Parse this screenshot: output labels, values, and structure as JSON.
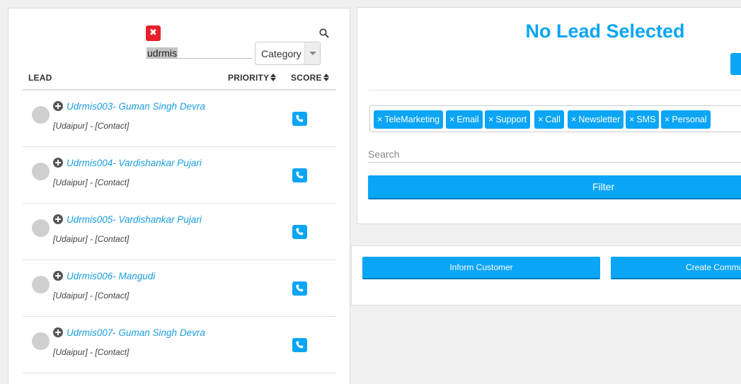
{
  "search": {
    "clear_symbol": "✖",
    "query": "udrmis",
    "category_selected": "Category"
  },
  "table": {
    "headers": {
      "lead": "LEAD",
      "priority": "PRIORITY",
      "score": "SCORE"
    },
    "rows": [
      {
        "name": "Udrmis003- Guman Singh Devra",
        "sub": "[Udaipur] - [Contact]"
      },
      {
        "name": "Udrmis004- Vardishankar Pujari",
        "sub": "[Udaipur] - [Contact]"
      },
      {
        "name": "Udrmis005- Vardishankar Pujari",
        "sub": "[Udaipur] - [Contact]"
      },
      {
        "name": "Udrmis006- Mangudi",
        "sub": "[Udaipur] - [Contact]"
      },
      {
        "name": "Udrmis007- Guman Singh Devra",
        "sub": "[Udaipur] - [Contact]"
      }
    ]
  },
  "detail": {
    "title": "No Lead Selected",
    "tags": [
      "TeleMarketing",
      "Email",
      "Support",
      "Call",
      "Newsletter",
      "SMS",
      "Personal"
    ],
    "tag_remove_symbol": "×",
    "search_placeholder": "Search",
    "filter_label": "Filter"
  },
  "actions": {
    "inform_label": "Inform Customer",
    "create_label": "Create Commu"
  },
  "colors": {
    "accent": "#0aa5f5",
    "danger": "#e8202a",
    "link": "#1a9de0"
  },
  "icons": {
    "search": "search-icon",
    "clear": "close-icon",
    "expand": "plus-circle-icon",
    "call": "phone-icon",
    "sort": "sort-icon"
  }
}
